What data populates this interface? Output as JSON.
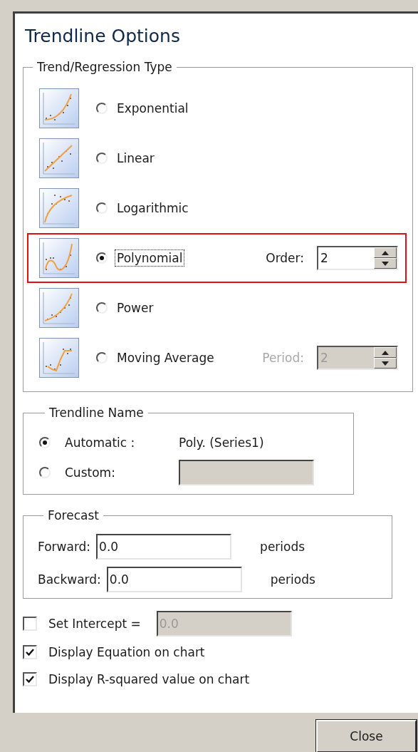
{
  "title": "Trendline Options",
  "regression": {
    "legend": "Trend/Regression Type",
    "types": [
      {
        "kind": "exponential",
        "label": "Exponential",
        "selected": false,
        "focused": false,
        "highlighted": false
      },
      {
        "kind": "linear",
        "label": "Linear",
        "selected": false,
        "focused": false,
        "highlighted": false
      },
      {
        "kind": "logarithmic",
        "label": "Logarithmic",
        "selected": false,
        "focused": false,
        "highlighted": false
      },
      {
        "kind": "polynomial",
        "label": "Polynomial",
        "selected": true,
        "focused": true,
        "highlighted": true,
        "option": {
          "label": "Order:",
          "value": "2",
          "disabled": false
        }
      },
      {
        "kind": "power",
        "label": "Power",
        "selected": false,
        "focused": false,
        "highlighted": false
      },
      {
        "kind": "moving_average",
        "label": "Moving Average",
        "selected": false,
        "focused": false,
        "highlighted": false,
        "option": {
          "label": "Period:",
          "value": "2",
          "disabled": true
        }
      }
    ]
  },
  "trendline_name": {
    "legend": "Trendline Name",
    "options": [
      {
        "label": "Automatic :",
        "selected": true,
        "value": "Poly. (Series1)"
      },
      {
        "label": "Custom:",
        "selected": false,
        "field_disabled": true
      }
    ]
  },
  "forecast": {
    "legend": "Forecast",
    "rows": [
      {
        "label": "Forward:",
        "value": "0.0",
        "unit": "periods"
      },
      {
        "label": "Backward:",
        "value": "0.0",
        "unit": "periods"
      }
    ]
  },
  "options": [
    {
      "kind": "field",
      "label": "Set Intercept =",
      "checked": false,
      "value": "0.0",
      "field_disabled": true
    },
    {
      "kind": "plain",
      "label": "Display Equation on chart",
      "checked": true
    },
    {
      "kind": "plain",
      "label": "Display R-squared value on chart",
      "checked": true
    }
  ],
  "buttons": [
    {
      "label": "Close"
    }
  ]
}
